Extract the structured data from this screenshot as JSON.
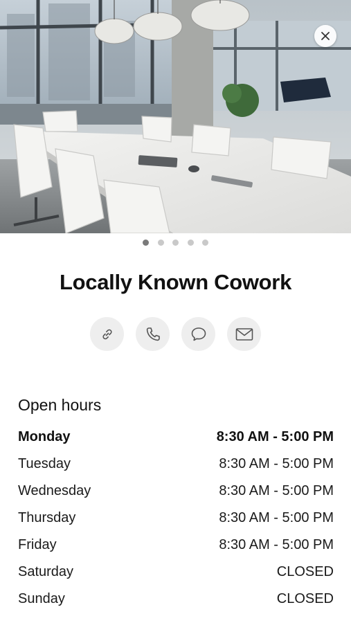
{
  "place": {
    "name": "Locally Known Cowork"
  },
  "carousel": {
    "total": 5,
    "active_index": 0
  },
  "actions": [
    {
      "id": "website",
      "icon": "link-icon"
    },
    {
      "id": "call",
      "icon": "phone-icon"
    },
    {
      "id": "message",
      "icon": "chat-bubble-icon"
    },
    {
      "id": "email",
      "icon": "mail-icon"
    }
  ],
  "hours": {
    "title": "Open hours",
    "days": [
      {
        "day": "Monday",
        "time": "8:30 AM - 5:00 PM",
        "today": true
      },
      {
        "day": "Tuesday",
        "time": "8:30 AM - 5:00 PM",
        "today": false
      },
      {
        "day": "Wednesday",
        "time": "8:30 AM - 5:00 PM",
        "today": false
      },
      {
        "day": "Thursday",
        "time": "8:30 AM - 5:00 PM",
        "today": false
      },
      {
        "day": "Friday",
        "time": "8:30 AM - 5:00 PM",
        "today": false
      },
      {
        "day": "Saturday",
        "time": "CLOSED",
        "today": false
      },
      {
        "day": "Sunday",
        "time": "CLOSED",
        "today": false
      }
    ]
  },
  "colors": {
    "icon_gray": "#555555",
    "button_bg": "#eeeeee",
    "dot_active": "#7a7a7a",
    "dot_inactive": "#c9c9c9"
  }
}
